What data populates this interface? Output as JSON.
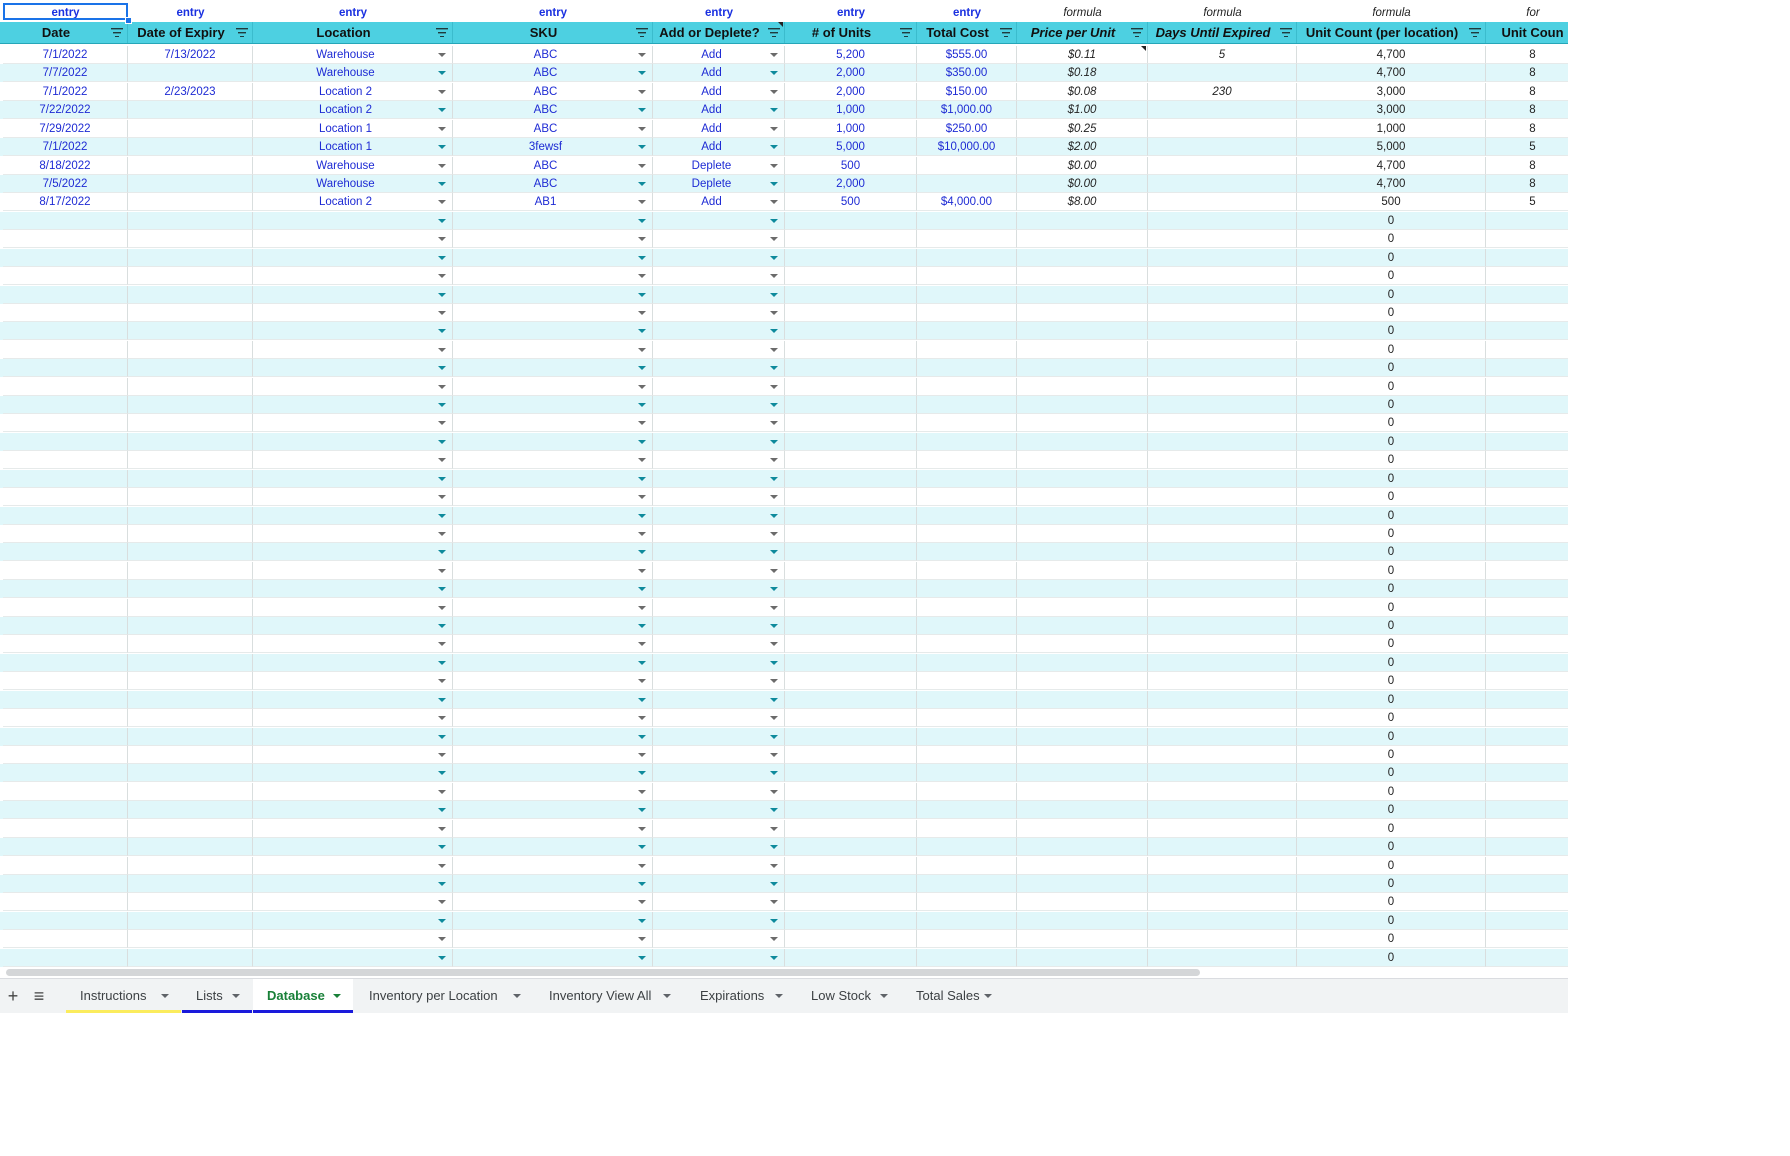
{
  "columns": [
    {
      "kind": "entry",
      "header": "Date",
      "italic": false,
      "filter": true
    },
    {
      "kind": "entry",
      "header": "Date of Expiry",
      "italic": false,
      "filter": true
    },
    {
      "kind": "entry",
      "header": "Location",
      "italic": false,
      "filter": true
    },
    {
      "kind": "entry",
      "header": "SKU",
      "italic": false,
      "filter": true
    },
    {
      "kind": "entry",
      "header": "Add or Deplete?",
      "italic": false,
      "filter": true
    },
    {
      "kind": "entry",
      "header": "# of Units",
      "italic": false,
      "filter": true
    },
    {
      "kind": "entry",
      "header": "Total Cost",
      "italic": false,
      "filter": true
    },
    {
      "kind": "formula",
      "header": "Price per Unit",
      "italic": true,
      "filter": true
    },
    {
      "kind": "formula",
      "header": "Days Until Expired",
      "italic": true,
      "filter": true
    },
    {
      "kind": "formula",
      "header": "Unit Count (per location)",
      "italic": false,
      "filter": true
    },
    {
      "kind": "for",
      "header": "Unit Coun",
      "italic": false,
      "filter": false
    }
  ],
  "rows": [
    [
      "7/1/2022",
      "7/13/2022",
      "Warehouse",
      "ABC",
      "Add",
      "5,200",
      "$555.00",
      "$0.11",
      "5",
      "4,700",
      "8"
    ],
    [
      "7/7/2022",
      "",
      "Warehouse",
      "ABC",
      "Add",
      "2,000",
      "$350.00",
      "$0.18",
      "",
      "4,700",
      "8"
    ],
    [
      "7/1/2022",
      "2/23/2023",
      "Location 2",
      "ABC",
      "Add",
      "2,000",
      "$150.00",
      "$0.08",
      "230",
      "3,000",
      "8"
    ],
    [
      "7/22/2022",
      "",
      "Location 2",
      "ABC",
      "Add",
      "1,000",
      "$1,000.00",
      "$1.00",
      "",
      "3,000",
      "8"
    ],
    [
      "7/29/2022",
      "",
      "Location 1",
      "ABC",
      "Add",
      "1,000",
      "$250.00",
      "$0.25",
      "",
      "1,000",
      "8"
    ],
    [
      "7/1/2022",
      "",
      "Location 1",
      "3fewsf",
      "Add",
      "5,000",
      "$10,000.00",
      "$2.00",
      "",
      "5,000",
      "5"
    ],
    [
      "8/18/2022",
      "",
      "Warehouse",
      "ABC",
      "Deplete",
      "500",
      "",
      "$0.00",
      "",
      "4,700",
      "8"
    ],
    [
      "7/5/2022",
      "",
      "Warehouse",
      "ABC",
      "Deplete",
      "2,000",
      "",
      "$0.00",
      "",
      "4,700",
      "8"
    ],
    [
      "8/17/2022",
      "",
      "Location 2",
      "AB1",
      "Add",
      "500",
      "$4,000.00",
      "$8.00",
      "",
      "500",
      "5"
    ]
  ],
  "empty_unit_count": "0",
  "empty_row_count": 41,
  "tabs": [
    {
      "label": "Instructions",
      "underline": "#fbec5d",
      "active": false
    },
    {
      "label": "Lists",
      "underline": "#1a1adb",
      "active": false
    },
    {
      "label": "Database",
      "underline": "#1a1adb",
      "active": true
    },
    {
      "label": "Inventory per Location",
      "underline": "",
      "active": false
    },
    {
      "label": "Inventory View All",
      "underline": "",
      "active": false
    },
    {
      "label": "Expirations",
      "underline": "",
      "active": false
    },
    {
      "label": "Low Stock",
      "underline": "",
      "active": false
    },
    {
      "label": "Total Sales",
      "underline": "",
      "active": false
    }
  ],
  "toolbar": {
    "add_sheet": "+",
    "all_sheets": "≡"
  },
  "colors": {
    "header_bg": "#4dd0e1",
    "band_bg": "#e0f7fa",
    "entry_text": "#1e2bd4",
    "active_tab_text": "#188038"
  }
}
